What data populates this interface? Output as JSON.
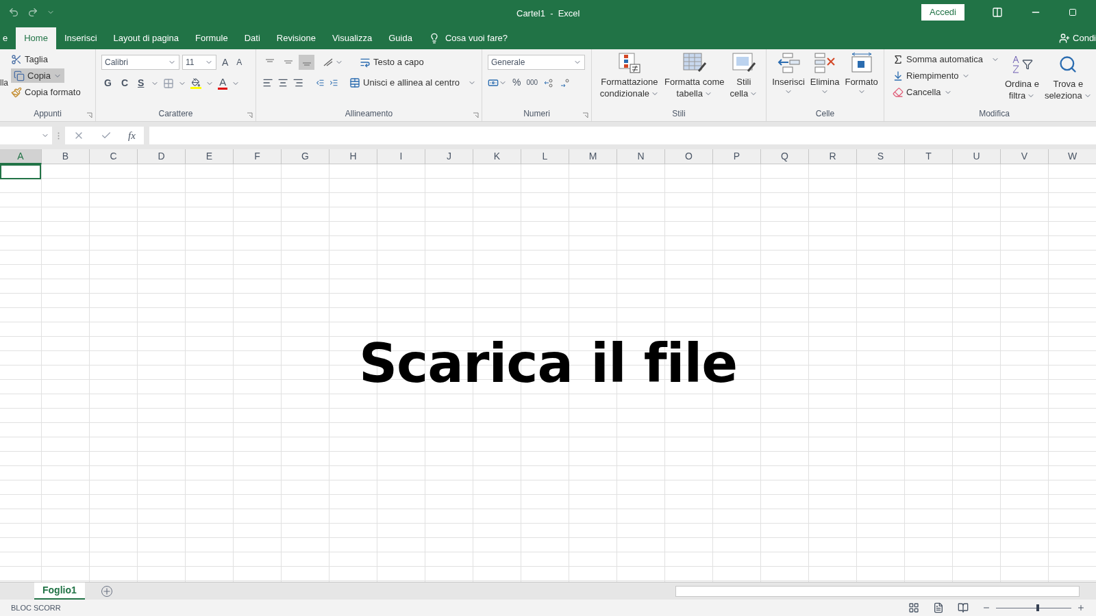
{
  "window": {
    "title": "Cartel1  -  Excel",
    "sign_in": "Accedi"
  },
  "ribbon_tabs": [
    {
      "label": "e",
      "selected": false
    },
    {
      "label": "Home",
      "selected": true
    },
    {
      "label": "Inserisci",
      "selected": false
    },
    {
      "label": "Layout di pagina",
      "selected": false
    },
    {
      "label": "Formule",
      "selected": false
    },
    {
      "label": "Dati",
      "selected": false
    },
    {
      "label": "Revisione",
      "selected": false
    },
    {
      "label": "Visualizza",
      "selected": false
    },
    {
      "label": "Guida",
      "selected": false
    }
  ],
  "tell_me": "Cosa vuoi fare?",
  "share": "Condi",
  "clipboard": {
    "paste": "lla",
    "cut": "Taglia",
    "copy": "Copia",
    "copy_selected": true,
    "format_painter": "Copia formato",
    "group": "Appunti"
  },
  "font": {
    "name": "Calibri",
    "size": "11",
    "grow": "A",
    "shrink": "A",
    "bold": "G",
    "italic": "C",
    "underline": "S",
    "font_color": "A",
    "group": "Carattere"
  },
  "alignment": {
    "vertical_align": [
      {
        "selected": false
      },
      {
        "selected": false
      },
      {
        "selected": true
      }
    ],
    "wrap": "Testo a capo",
    "merge": "Unisci e allinea al centro",
    "group": "Allineamento"
  },
  "number": {
    "format": "Generale",
    "percent": "%",
    "thousands": "000",
    "group": "Numeri"
  },
  "styles": {
    "buttons": [
      {
        "kind": "conditional",
        "lines": [
          "Formattazione",
          "condizionale"
        ]
      },
      {
        "kind": "table",
        "lines": [
          "Formatta come",
          "tabella"
        ]
      },
      {
        "kind": "cell",
        "lines": [
          "Stili",
          "cella"
        ]
      }
    ],
    "group": "Stili"
  },
  "cells": {
    "buttons": [
      {
        "kind": "insert",
        "label": "Inserisci"
      },
      {
        "kind": "delete",
        "label": "Elimina"
      },
      {
        "kind": "format",
        "label": "Formato"
      }
    ],
    "group": "Celle"
  },
  "editing": {
    "autosum": "Somma automatica",
    "fill": "Riempimento",
    "clear": "Cancella",
    "sort": [
      "Ordina e",
      "filtra"
    ],
    "find": [
      "Trova e",
      "seleziona"
    ],
    "group": "Modifica"
  },
  "formula_bar": {
    "fx": "fx"
  },
  "columns": [
    {
      "label": "A",
      "selected": true
    },
    {
      "label": "B",
      "selected": false
    },
    {
      "label": "C",
      "selected": false
    },
    {
      "label": "D",
      "selected": false
    },
    {
      "label": "E",
      "selected": false
    },
    {
      "label": "F",
      "selected": false
    },
    {
      "label": "G",
      "selected": false
    },
    {
      "label": "H",
      "selected": false
    },
    {
      "label": "I",
      "selected": false
    },
    {
      "label": "J",
      "selected": false
    },
    {
      "label": "K",
      "selected": false
    },
    {
      "label": "L",
      "selected": false
    },
    {
      "label": "M",
      "selected": false
    },
    {
      "label": "N",
      "selected": false
    },
    {
      "label": "O",
      "selected": false
    },
    {
      "label": "P",
      "selected": false
    },
    {
      "label": "Q",
      "selected": false
    },
    {
      "label": "R",
      "selected": false
    },
    {
      "label": "S",
      "selected": false
    },
    {
      "label": "T",
      "selected": false
    },
    {
      "label": "U",
      "selected": false
    },
    {
      "label": "V",
      "selected": false
    },
    {
      "label": "W",
      "selected": false
    }
  ],
  "overlay_text": "Scarica il file",
  "sheet_tabs": [
    {
      "label": "Foglio1",
      "selected": true
    }
  ],
  "status_bar": {
    "text": "BLOC SCORR"
  },
  "zoom": {
    "level": 0.55
  }
}
